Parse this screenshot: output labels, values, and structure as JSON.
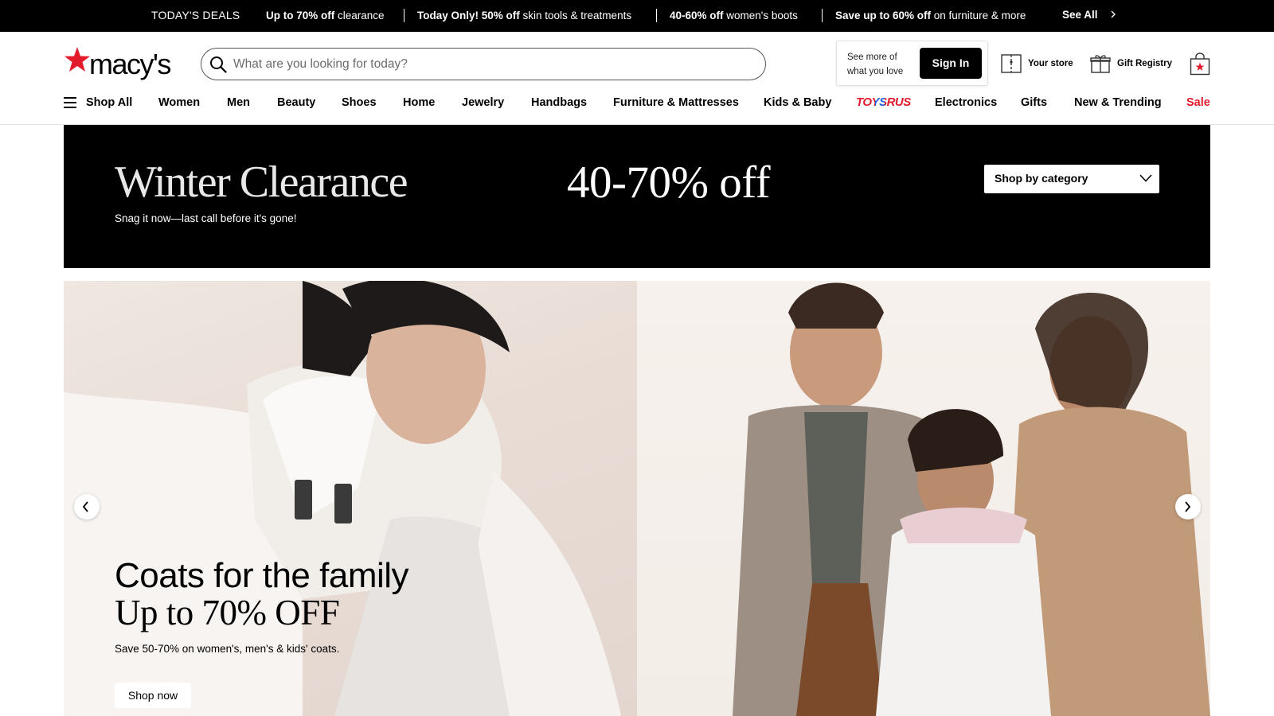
{
  "deals_bar": {
    "title": "TODAY'S DEALS",
    "items": [
      {
        "bold": "Up to 70% off",
        "rest": " clearance"
      },
      {
        "bold": "Today Only! 50% off",
        "rest": " skin tools & treatments"
      },
      {
        "bold": "40-60% off",
        "rest": " women's boots"
      },
      {
        "bold": "Save up to 60% off",
        "rest": " on furniture & more"
      }
    ],
    "see_all": "See All"
  },
  "header": {
    "logo_text": "macy's",
    "search_placeholder": "What are you looking for today?",
    "signin_hint": "See more of what you love",
    "signin_label": "Sign In",
    "your_store": "Your store",
    "gift_registry": "Gift Registry"
  },
  "nav": {
    "shop_all": "Shop All",
    "items": [
      "Women",
      "Men",
      "Beauty",
      "Shoes",
      "Home",
      "Jewelry",
      "Handbags",
      "Furniture & Mattresses",
      "Kids & Baby",
      "TOYSRUS",
      "Electronics",
      "Gifts",
      "New & Trending",
      "Sale"
    ]
  },
  "winter_banner": {
    "title": "Winter Clearance",
    "subtitle": "Snag it now—last call before it's gone!",
    "discount": "40-70% off",
    "shop_by_category": "Shop by category"
  },
  "hero": {
    "headline_1": "Coats for the family",
    "headline_2": "Up to 70% OFF",
    "subtitle": "Save 50-70% on women's, men's & kids' coats.",
    "cta": "Shop now"
  },
  "colors": {
    "brand_red": "#e21a2c",
    "black": "#000000"
  }
}
